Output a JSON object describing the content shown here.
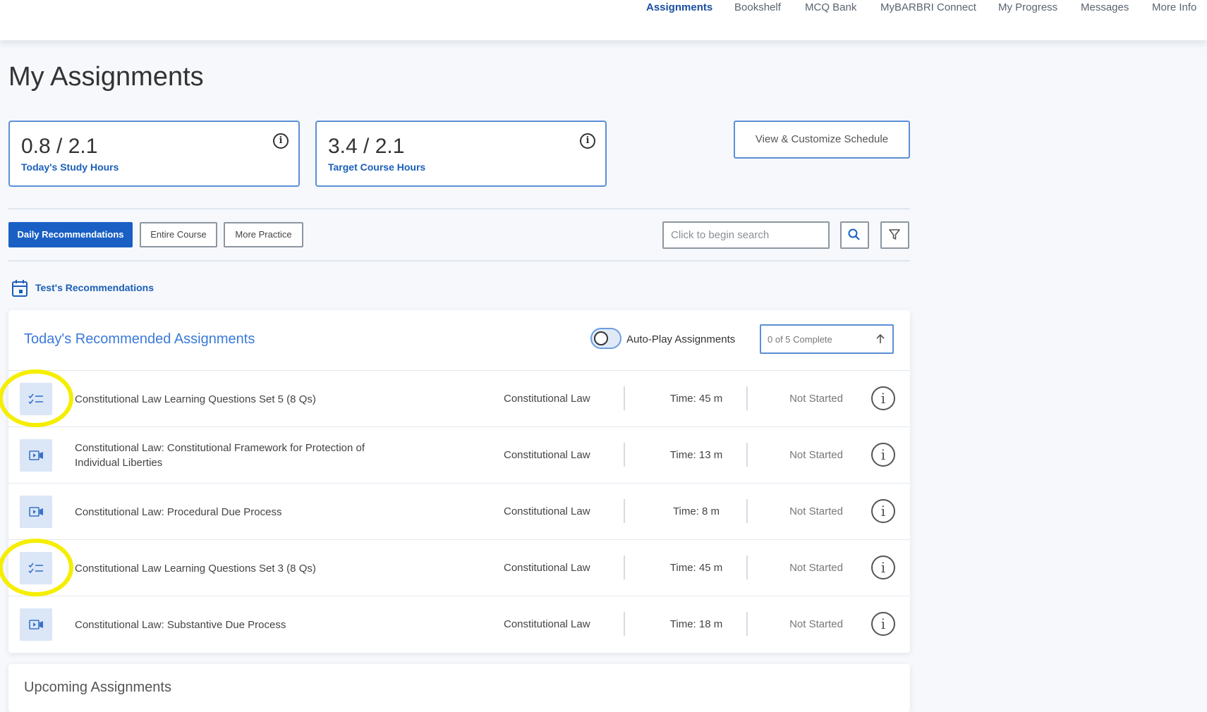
{
  "nav": {
    "items": [
      {
        "label": "Assignments",
        "active": true
      },
      {
        "label": "Bookshelf",
        "active": false
      },
      {
        "label": "MCQ Bank",
        "active": false
      },
      {
        "label": "MyBARBRI Connect",
        "active": false
      },
      {
        "label": "My Progress",
        "active": false
      },
      {
        "label": "Messages",
        "active": false
      },
      {
        "label": "More Info",
        "active": false
      }
    ]
  },
  "page": {
    "title": "My Assignments"
  },
  "stats": [
    {
      "value": "0.8 / 2.1",
      "label": "Today's Study Hours",
      "info_icon": "info-icon"
    },
    {
      "value": "3.4 / 2.1",
      "label": "Target Course Hours",
      "info_icon": "info-icon"
    }
  ],
  "schedule_button": {
    "label": "View & Customize Schedule"
  },
  "tabs": [
    {
      "label": "Daily Recommendations",
      "active": true
    },
    {
      "label": "Entire Course",
      "active": false
    },
    {
      "label": "More Practice",
      "active": false
    }
  ],
  "search": {
    "placeholder": "Click to begin search",
    "value": ""
  },
  "recommendation_header": {
    "label": "Test's Recommendations",
    "icon": "calendar-icon"
  },
  "recommended": {
    "title": "Today's Recommended Assignments",
    "autoplay_label": "Auto-Play Assignments",
    "autoplay_on": false,
    "progress_label": "0 of 5 Complete",
    "rows": [
      {
        "type": "questions",
        "icon": "checklist-icon",
        "title": "Constitutional Law Learning Questions Set 5 (8 Qs)",
        "subject": "Constitutional Law",
        "time": "Time: 45 m",
        "status": "Not Started"
      },
      {
        "type": "video",
        "icon": "video-lecture-icon",
        "title": "Constitutional Law: Constitutional Framework for Protection of Individual Liberties",
        "subject": "Constitutional Law",
        "time": "Time: 13 m",
        "status": "Not Started"
      },
      {
        "type": "video",
        "icon": "video-lecture-icon",
        "title": "Constitutional Law: Procedural Due Process",
        "subject": "Constitutional Law",
        "time": "Time: 8 m",
        "status": "Not Started"
      },
      {
        "type": "questions",
        "icon": "checklist-icon",
        "title": "Constitutional Law Learning Questions Set 3 (8 Qs)",
        "subject": "Constitutional Law",
        "time": "Time: 45 m",
        "status": "Not Started"
      },
      {
        "type": "video",
        "icon": "video-lecture-icon",
        "title": "Constitutional Law: Substantive Due Process",
        "subject": "Constitutional Law",
        "time": "Time: 18 m",
        "status": "Not Started"
      }
    ]
  },
  "upcoming": {
    "title": "Upcoming Assignments"
  },
  "colors": {
    "accent": "#1a5fc4",
    "highlight": "#f5ee00",
    "card_border": "#5b8fd6"
  }
}
